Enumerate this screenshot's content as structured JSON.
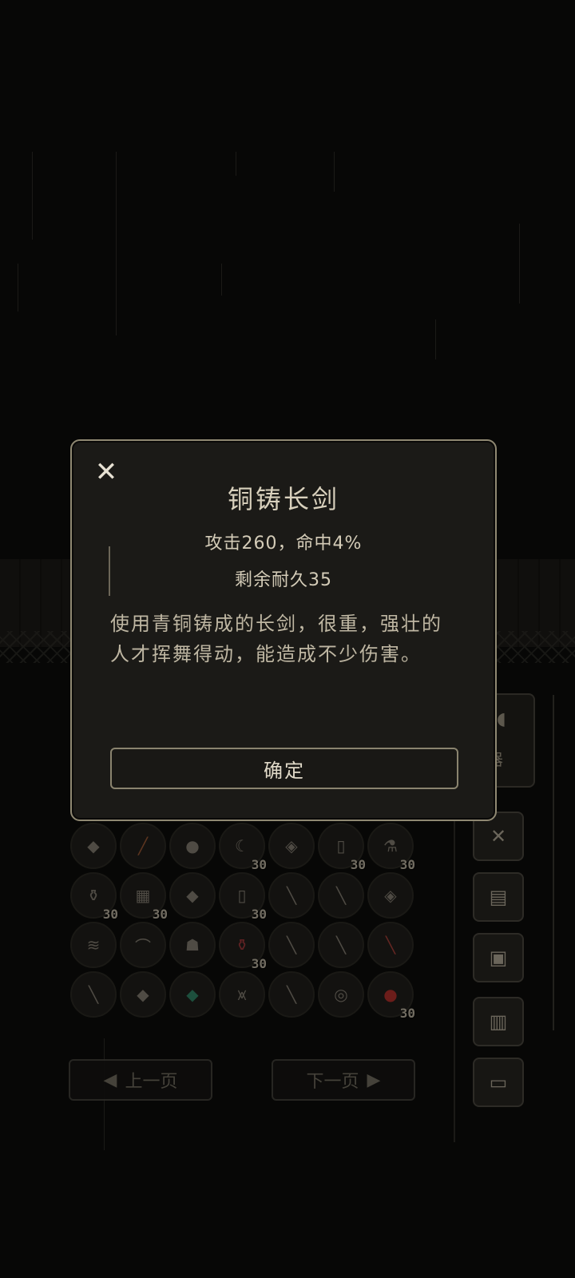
{
  "dialog": {
    "close_icon": "close-icon",
    "title": "铜铸长剑",
    "stats_line1": "攻击260，命中4%",
    "stats_line2": "剩余耐久35",
    "description": "使用青铜铸成的长剑，很重，强壮的人才挥舞得动，能造成不少伤害。",
    "confirm_label": "确定"
  },
  "pagination": {
    "prev_label": "上一页",
    "next_label": "下一页"
  },
  "side_menu": {
    "partial_label": "器"
  },
  "inventory": {
    "slots": [
      {
        "icon": "crystal-icon",
        "count": ""
      },
      {
        "icon": "torch-icon",
        "count": ""
      },
      {
        "icon": "berries-icon",
        "count": ""
      },
      {
        "icon": "horn-icon",
        "count": "30"
      },
      {
        "icon": "ore-icon",
        "count": ""
      },
      {
        "icon": "bottle-icon",
        "count": "30"
      },
      {
        "icon": "flask-icon",
        "count": "30"
      },
      {
        "icon": "potion-icon",
        "count": "30"
      },
      {
        "icon": "cloth-icon",
        "count": "30"
      },
      {
        "icon": "crystal-icon",
        "count": ""
      },
      {
        "icon": "bottle-icon",
        "count": "30"
      },
      {
        "icon": "knife-icon",
        "count": ""
      },
      {
        "icon": "sword-icon",
        "count": ""
      },
      {
        "icon": "ore-icon",
        "count": ""
      },
      {
        "icon": "scroll-icon",
        "count": ""
      },
      {
        "icon": "bow-icon",
        "count": ""
      },
      {
        "icon": "armor-icon",
        "count": ""
      },
      {
        "icon": "red-potion-icon",
        "count": "30"
      },
      {
        "icon": "sword-icon",
        "count": ""
      },
      {
        "icon": "sword-icon",
        "count": ""
      },
      {
        "icon": "red-sword-icon",
        "count": ""
      },
      {
        "icon": "knife-icon",
        "count": ""
      },
      {
        "icon": "crystal-icon",
        "count": ""
      },
      {
        "icon": "green-crystal-icon",
        "count": ""
      },
      {
        "icon": "robe-icon",
        "count": ""
      },
      {
        "icon": "knife-icon",
        "count": ""
      },
      {
        "icon": "shield-icon",
        "count": ""
      },
      {
        "icon": "apple-icon",
        "count": "30"
      }
    ]
  }
}
